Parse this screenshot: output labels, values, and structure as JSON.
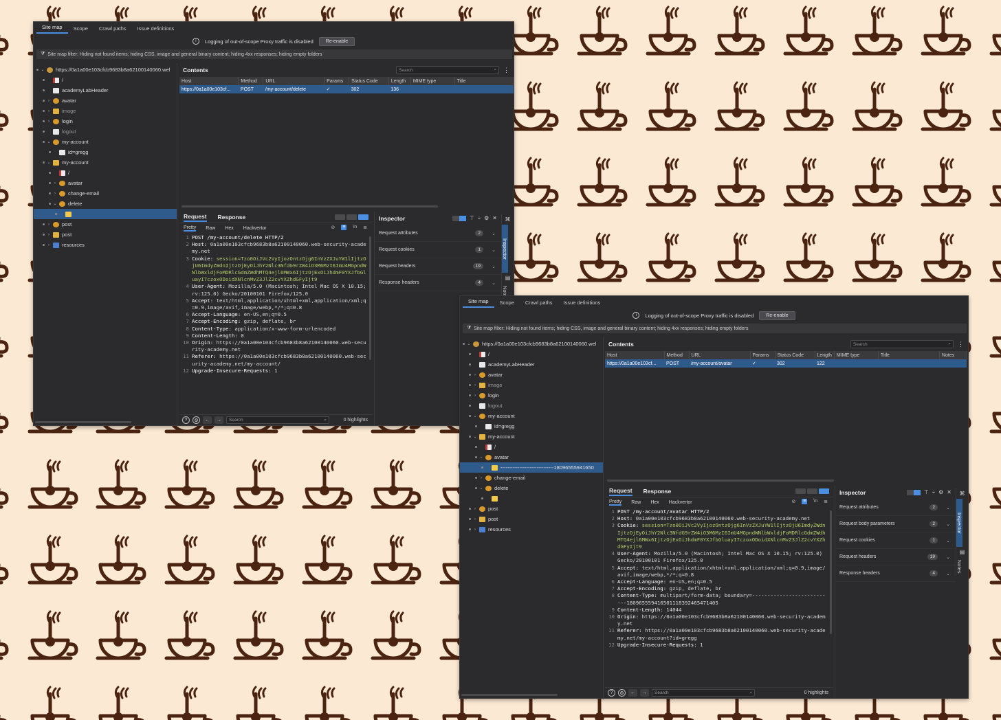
{
  "colors": {
    "background": "#fbe9d3",
    "logo": "#4a2411",
    "panel": "#2b2b2d",
    "selection": "#2f5a8c",
    "accent": "#4a8fe2",
    "code_value": "#b5cc6a"
  },
  "windows": [
    {
      "tabs": [
        "Site map",
        "Scope",
        "Crawl paths",
        "Issue definitions"
      ],
      "notice": {
        "text": "Logging of out-of-scope Proxy traffic is disabled",
        "button": "Re-enable"
      },
      "filter_text": "Site map filter: Hiding not found items;  hiding CSS, image and general binary content;  hiding 4xx responses;  hiding empty folders",
      "tree": [
        {
          "label": "https://0a1a00e103cfcb9683b8a62100140060.wel",
          "icon": "site",
          "level": 0,
          "chev": "v"
        },
        {
          "label": "/",
          "icon": "page",
          "level": 1,
          "chev": ""
        },
        {
          "label": "academyLabHeader",
          "icon": "file",
          "level": 1,
          "chev": ""
        },
        {
          "label": "avatar",
          "icon": "gear",
          "level": 1,
          "chev": ">"
        },
        {
          "label": "image",
          "icon": "folder",
          "level": 1,
          "chev": ">",
          "dim": true
        },
        {
          "label": "login",
          "icon": "gear",
          "level": 1,
          "chev": ">"
        },
        {
          "label": "logout",
          "icon": "file",
          "level": 1,
          "chev": "",
          "dim": true
        },
        {
          "label": "my-account",
          "icon": "gear",
          "level": 1,
          "chev": "v"
        },
        {
          "label": "id=gregg",
          "icon": "file",
          "level": 2,
          "chev": ""
        },
        {
          "label": "my-account",
          "icon": "folder",
          "level": 1,
          "chev": "v"
        },
        {
          "label": "/",
          "icon": "page",
          "level": 2,
          "chev": ""
        },
        {
          "label": "avatar",
          "icon": "gear",
          "level": 2,
          "chev": ">"
        },
        {
          "label": "change-email",
          "icon": "gear",
          "level": 2,
          "chev": ">"
        },
        {
          "label": "delete",
          "icon": "gear",
          "level": 2,
          "chev": "v"
        },
        {
          "label": "",
          "icon": "mail",
          "level": 3,
          "chev": "",
          "selected": true
        },
        {
          "label": "post",
          "icon": "gear",
          "level": 1,
          "chev": ">"
        },
        {
          "label": "post",
          "icon": "folder",
          "level": 1,
          "chev": ">"
        },
        {
          "label": "resources",
          "icon": "blue",
          "level": 1,
          "chev": ">"
        }
      ],
      "contents": {
        "title": "Contents",
        "search_placeholder": "Search",
        "columns": [
          "Host",
          "Method",
          "URL",
          "Params",
          "Status Code",
          "Length",
          "MIME type",
          "Title"
        ],
        "rows": [
          [
            "https://0a1a00e103cf...",
            "POST",
            "/my-account/delete",
            "✓",
            "302",
            "136",
            "",
            ""
          ]
        ]
      },
      "request": {
        "tabs": [
          "Request",
          "Response"
        ],
        "subtabs": [
          "Pretty",
          "Raw",
          "Hex",
          "Hackvertor"
        ],
        "lines": [
          {
            "n": "1",
            "key": "POST /my-account/delete HTTP/2",
            "val": "",
            "green": false
          },
          {
            "n": "2",
            "key": "Host:",
            "val": "0a1a00e103cfcb9683b8a62100140060.web-security-academy.net",
            "green": false
          },
          {
            "n": "3",
            "key": "Cookie:",
            "val": "session=Tzo0OiJVc2VyIjozOntzOjg6InVzZXJuYW1lIjtzOjU6ImdyZWdnIjtzOjEyOiJhY2Nlc3NfdG9rZW4iO3M6MzI6ImU4MGpndWNlbWxldjFoMDRlcGdmZWdhMTQ4ejl6MWx6IjtzOjExOiJhdmF0YXJfbGluayI7czoxODoidXNlcnMvZ3JlZ2cvYXZhdGFyIjt9",
            "green": true
          },
          {
            "n": "4",
            "key": "User-Agent:",
            "val": "Mozilla/5.0 (Macintosh; Intel Mac OS X 10.15; rv:125.0) Gecko/20100101 Firefox/125.0",
            "green": false
          },
          {
            "n": "5",
            "key": "Accept:",
            "val": "text/html,application/xhtml+xml,application/xml;q=0.9,image/avif,image/webp,*/*;q=0.8",
            "green": false
          },
          {
            "n": "6",
            "key": "Accept-Language:",
            "val": "en-US,en;q=0.5",
            "green": false
          },
          {
            "n": "7",
            "key": "Accept-Encoding:",
            "val": "gzip, deflate, br",
            "green": false
          },
          {
            "n": "8",
            "key": "Content-Type:",
            "val": "application/x-www-form-urlencoded",
            "green": false
          },
          {
            "n": "9",
            "key": "Content-Length:",
            "val": "0",
            "green": false
          },
          {
            "n": "10",
            "key": "Origin:",
            "val": "https://0a1a00e103cfcb9683b8a62100140060.web-security-academy.net",
            "green": false
          },
          {
            "n": "11",
            "key": "Referer:",
            "val": "https://0a1a00e103cfcb9683b8a62100140060.web-security-academy.net/my-account/",
            "green": false
          },
          {
            "n": "12",
            "key": "Upgrade-Insecure-Requests:",
            "val": "1",
            "green": false
          }
        ],
        "footer_search": "Search",
        "highlights": "0 highlights"
      },
      "inspector": {
        "title": "Inspector",
        "rows": [
          {
            "label": "Request attributes",
            "count": "2"
          },
          {
            "label": "Request cookies",
            "count": "1"
          },
          {
            "label": "Request headers",
            "count": "19"
          },
          {
            "label": "Response headers",
            "count": "4"
          }
        ],
        "rail": [
          "Inspector",
          "Notes"
        ]
      }
    },
    {
      "tabs": [
        "Site map",
        "Scope",
        "Crawl paths",
        "Issue definitions"
      ],
      "notice": {
        "text": "Logging of out-of-scope Proxy traffic is disabled",
        "button": "Re-enable"
      },
      "filter_text": "Site map filter: Hiding not found items;  hiding CSS, image and general binary content;  hiding 4xx responses;  hiding empty folders",
      "tree": [
        {
          "label": "https://0a1a00e103cfcb9683b8a62100140060.wel",
          "icon": "site",
          "level": 0,
          "chev": "v"
        },
        {
          "label": "/",
          "icon": "page",
          "level": 1,
          "chev": ""
        },
        {
          "label": "academyLabHeader",
          "icon": "file",
          "level": 1,
          "chev": ""
        },
        {
          "label": "avatar",
          "icon": "gear",
          "level": 1,
          "chev": ">"
        },
        {
          "label": "image",
          "icon": "folder",
          "level": 1,
          "chev": ">",
          "dim": true
        },
        {
          "label": "login",
          "icon": "gear",
          "level": 1,
          "chev": ">"
        },
        {
          "label": "logout",
          "icon": "file",
          "level": 1,
          "chev": "",
          "dim": true
        },
        {
          "label": "my-account",
          "icon": "gear",
          "level": 1,
          "chev": "v"
        },
        {
          "label": "id=gregg",
          "icon": "file",
          "level": 2,
          "chev": ""
        },
        {
          "label": "my-account",
          "icon": "folder",
          "level": 1,
          "chev": "v"
        },
        {
          "label": "/",
          "icon": "page",
          "level": 2,
          "chev": ""
        },
        {
          "label": "avatar",
          "icon": "gear",
          "level": 2,
          "chev": "v"
        },
        {
          "label": "",
          "icon": "mail",
          "level": 3,
          "chev": "",
          "selected": true,
          "suffix": "-------------------------------18096555941650"
        },
        {
          "label": "change-email",
          "icon": "gear",
          "level": 2,
          "chev": ">"
        },
        {
          "label": "delete",
          "icon": "gear",
          "level": 2,
          "chev": "v"
        },
        {
          "label": "",
          "icon": "mail",
          "level": 3,
          "chev": ""
        },
        {
          "label": "post",
          "icon": "gear",
          "level": 1,
          "chev": ">"
        },
        {
          "label": "post",
          "icon": "folder",
          "level": 1,
          "chev": ">"
        },
        {
          "label": "resources",
          "icon": "blue",
          "level": 1,
          "chev": ">"
        }
      ],
      "contents": {
        "title": "Contents",
        "search_placeholder": "Search",
        "columns": [
          "Host",
          "Method",
          "URL",
          "Params",
          "Status Code",
          "Length",
          "MIME type",
          "Title",
          "Notes"
        ],
        "rows": [
          [
            "https://0a1a00e103cf...",
            "POST",
            "/my-account/avatar",
            "✓",
            "302",
            "122",
            "",
            "",
            ""
          ]
        ]
      },
      "request": {
        "tabs": [
          "Request",
          "Response"
        ],
        "subtabs": [
          "Pretty",
          "Raw",
          "Hex",
          "Hackvertor"
        ],
        "lines": [
          {
            "n": "1",
            "key": "POST /my-account/avatar HTTP/2",
            "val": "",
            "green": false
          },
          {
            "n": "2",
            "key": "Host:",
            "val": "0a1a00e103cfcb9683b8a62100140060.web-security-academy.net",
            "green": false
          },
          {
            "n": "3",
            "key": "Cookie:",
            "val": "session=Tzo0OiJVc2VyIjozOntzOjg6InVzZXJuYW1lIjtzOjU6ImdyZWdnIjtzOjEyOiJhY2Nlc3NfdG9rZW4iO3M6MzI6ImU4MGpndWNlbWxldjFoMDRlcGdmZWdhMTQ4ejl6MWx6IjtzOjExOiJhdmF0YXJfbGluayI7czoxODoidXNlcnMvZ3JlZ2cvYXZhdGFyIjt9",
            "green": true
          },
          {
            "n": "4",
            "key": "User-Agent:",
            "val": "Mozilla/5.0 (Macintosh; Intel Mac OS X 10.15; rv:125.0) Gecko/20100101 Firefox/125.0",
            "green": false
          },
          {
            "n": "5",
            "key": "Accept:",
            "val": "text/html,application/xhtml+xml,application/xml;q=0.9,image/avif,image/webp,*/*;q=0.8",
            "green": false
          },
          {
            "n": "6",
            "key": "Accept-Language:",
            "val": "en-US,en;q=0.5",
            "green": false
          },
          {
            "n": "7",
            "key": "Accept-Encoding:",
            "val": "gzip, deflate, br",
            "green": false
          },
          {
            "n": "8",
            "key": "Content-Type:",
            "val": "multipart/form-data; boundary=---------------------------180965559416501118392465471405",
            "green": false
          },
          {
            "n": "9",
            "key": "Content-Length:",
            "val": "14044",
            "green": false
          },
          {
            "n": "10",
            "key": "Origin:",
            "val": "https://0a1a00e103cfcb9683b8a62100140060.web-security-academy.net",
            "green": false
          },
          {
            "n": "11",
            "key": "Referer:",
            "val": "https://0a1a00e103cfcb9683b8a62100140060.web-security-academy.net/my-account?id=gregg",
            "green": false
          },
          {
            "n": "12",
            "key": "Upgrade-Insecure-Requests:",
            "val": "1",
            "green": false
          }
        ],
        "footer_search": "Search",
        "highlights": "0 highlights"
      },
      "inspector": {
        "title": "Inspector",
        "rows": [
          {
            "label": "Request attributes",
            "count": "2"
          },
          {
            "label": "Request body parameters",
            "count": "2"
          },
          {
            "label": "Request cookies",
            "count": "1"
          },
          {
            "label": "Request headers",
            "count": "19"
          },
          {
            "label": "Response headers",
            "count": "4"
          }
        ],
        "rail": [
          "Inspector",
          "Notes"
        ]
      }
    }
  ]
}
